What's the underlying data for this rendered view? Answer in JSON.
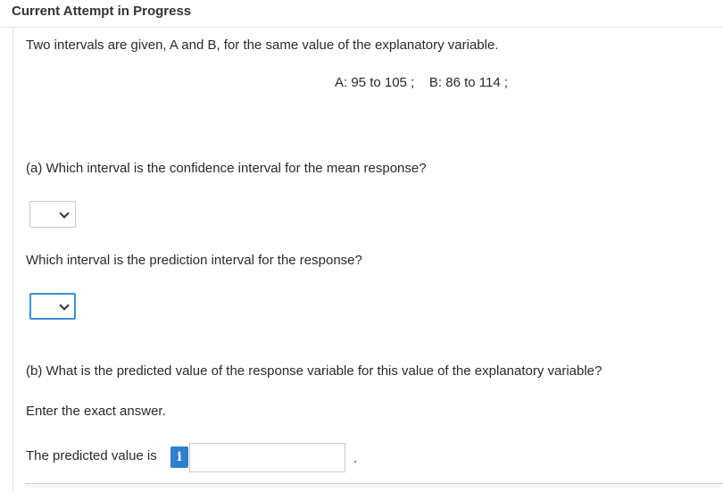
{
  "header": {
    "title": "Current Attempt in Progress"
  },
  "question": {
    "intro": "Two intervals are given, A and B, for the same value of the explanatory variable.",
    "intervals": "A: 95 to 105 ;    B: 86 to 114 ;",
    "part_a": {
      "prompt_1": "(a) Which interval is the confidence interval for the mean response?",
      "select_1_value": "",
      "prompt_2": "Which interval is the prediction interval for the response?",
      "select_2_value": ""
    },
    "part_b": {
      "prompt": "(b) What is the predicted value of the response variable for this value of the explanatory variable?",
      "instruction": "Enter the exact answer.",
      "answer_label": "The predicted value is",
      "info_icon_glyph": "i",
      "answer_value": "",
      "trailing_period": "."
    }
  },
  "colors": {
    "accent": "#2f7fd1",
    "focus": "#3b8fd9",
    "border": "#c8c8c8"
  },
  "icons": {
    "info": "info-icon",
    "dropdown": "chevron-down-icon"
  }
}
